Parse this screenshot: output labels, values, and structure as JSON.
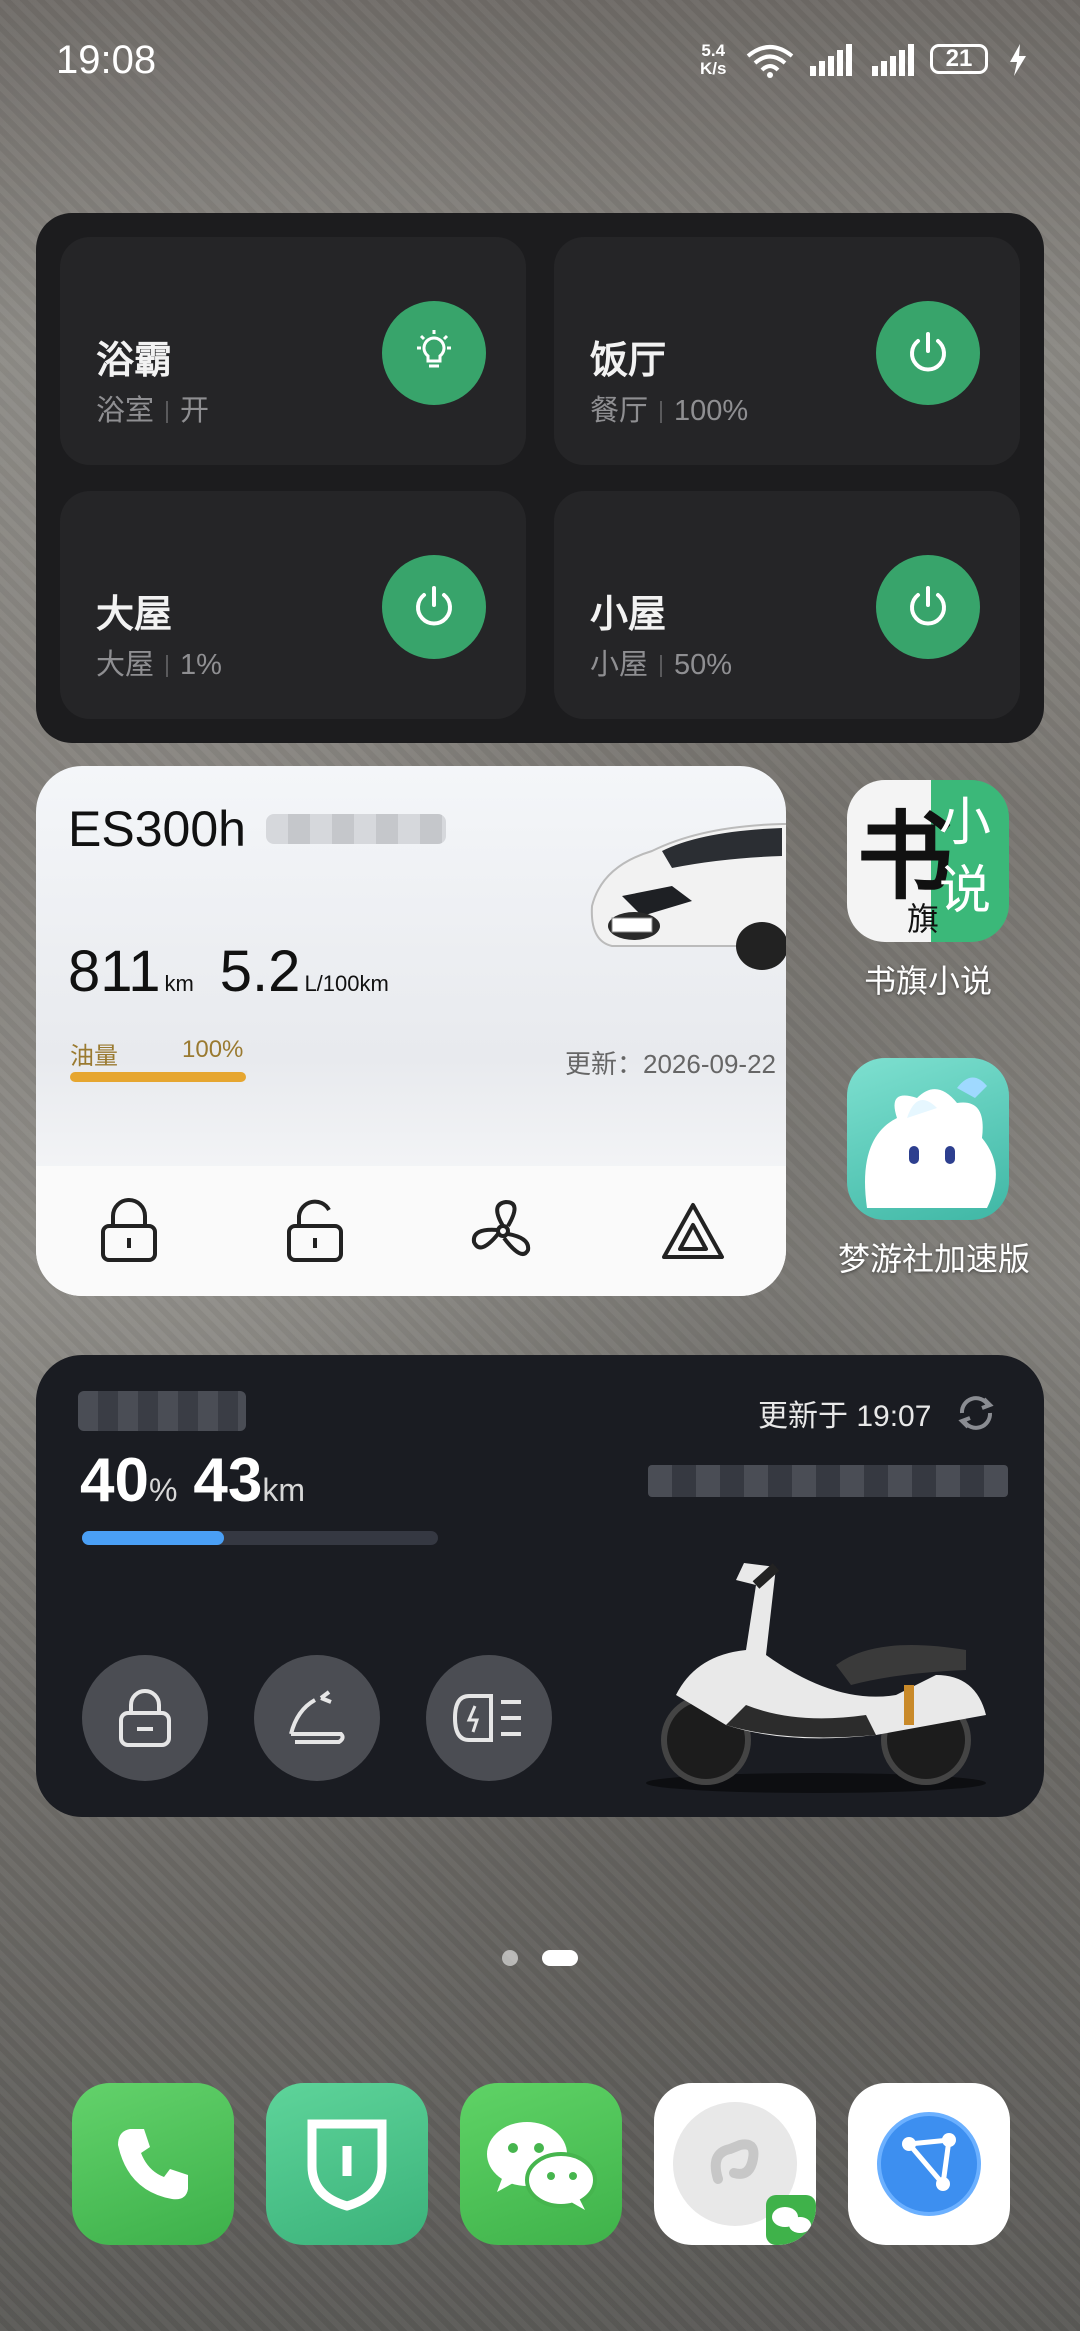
{
  "status_bar": {
    "time": "19:08",
    "net_speed_value": "5.4",
    "net_speed_unit": "K/s",
    "battery": "21"
  },
  "smart_home": {
    "tiles": [
      {
        "title": "浴霸",
        "room": "浴室",
        "state": "开",
        "icon": "bulb-icon"
      },
      {
        "title": "饭厅",
        "room": "餐厅",
        "state": "100%",
        "icon": "power-icon"
      },
      {
        "title": "大屋",
        "room": "大屋",
        "state": "1%",
        "icon": "power-icon"
      },
      {
        "title": "小屋",
        "room": "小屋",
        "state": "50%",
        "icon": "power-icon"
      }
    ],
    "accent_color": "#38a46b"
  },
  "car": {
    "name": "ES300h",
    "range_value": "811",
    "range_unit": "km",
    "consumption_value": "5.2",
    "consumption_unit": "L/100km",
    "fuel_label": "油量",
    "fuel_value": "100%",
    "fuel_level": 1.0,
    "updated": "更新：2026-09-22",
    "actions": [
      "lock-icon",
      "unlock-icon",
      "fan-icon",
      "hazard-icon"
    ]
  },
  "apps": {
    "shuqi": {
      "label": "书旗小说"
    },
    "mengyou": {
      "label": "梦游社加速版"
    }
  },
  "scooter": {
    "updated": "更新于 19:07",
    "battery_value": "40",
    "battery_unit": "%",
    "range_value": "43",
    "range_unit": "km",
    "battery_level": 0.4,
    "bar_color": "#4a9ff5",
    "buttons": [
      "lock-icon",
      "seat-icon",
      "headlight-icon"
    ]
  },
  "page_indicator": {
    "pages": 2,
    "current": 2
  },
  "dock": [
    "phone-icon",
    "mi-home-icon",
    "wechat-icon",
    "mini-program-icon",
    "browser-icon"
  ]
}
